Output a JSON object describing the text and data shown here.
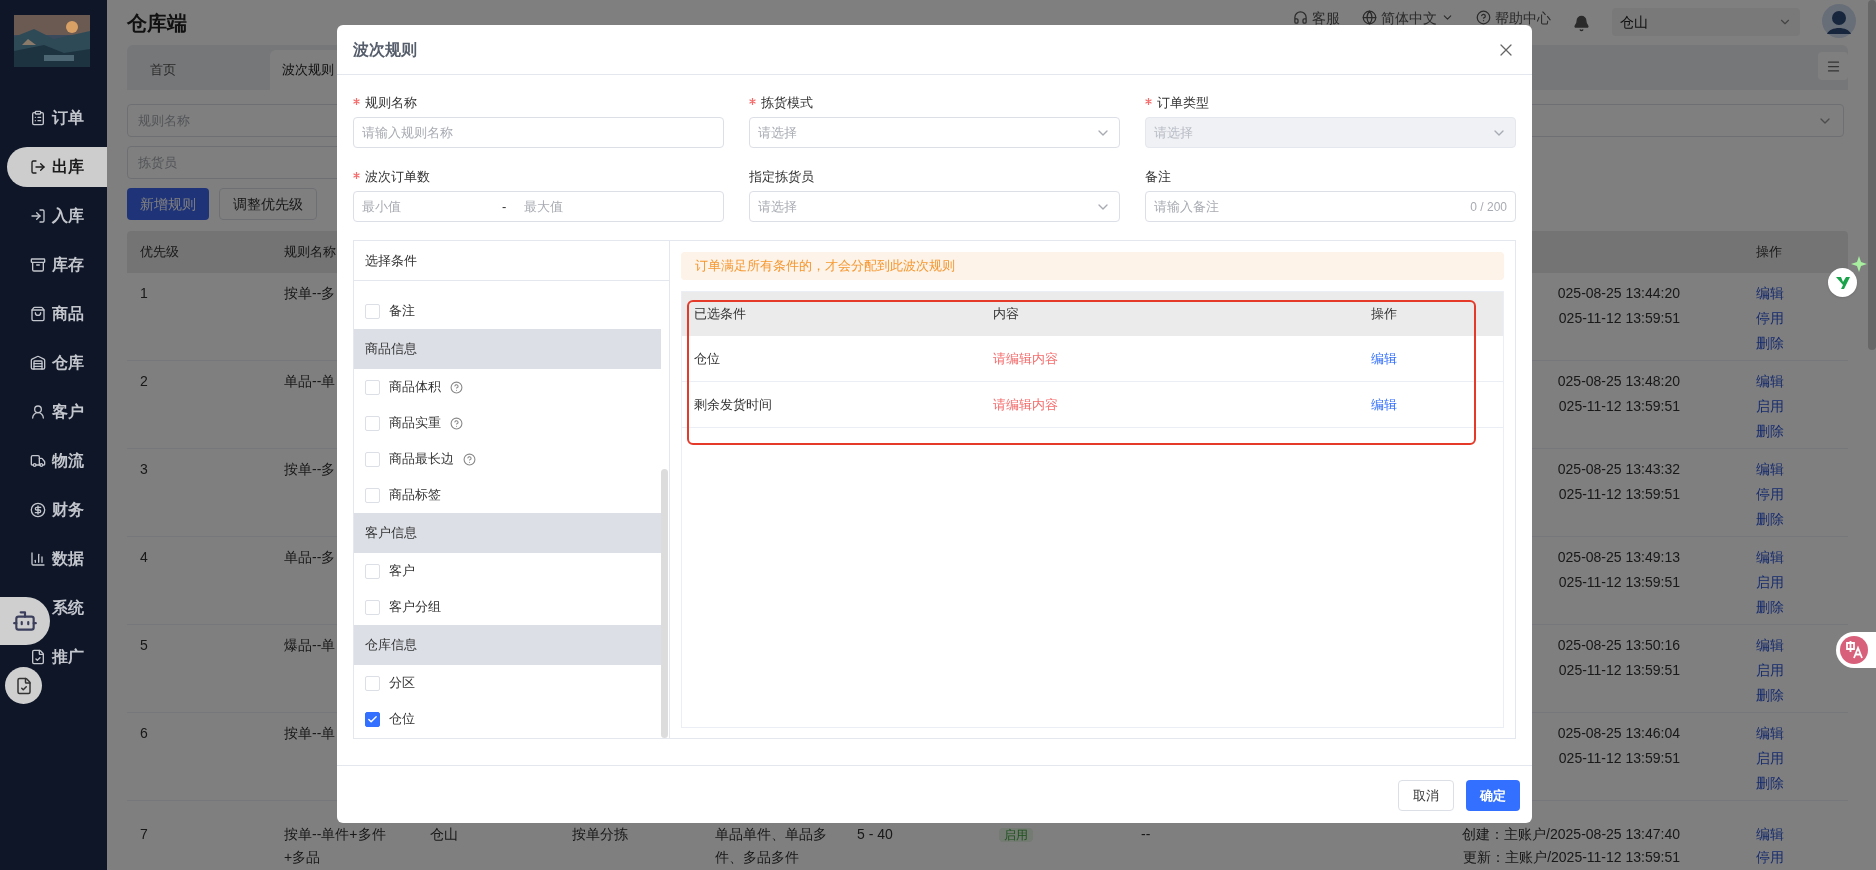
{
  "sidebar": {
    "items": [
      {
        "label": "订单",
        "selected": false
      },
      {
        "label": "出库",
        "selected": true
      },
      {
        "label": "入库",
        "selected": false
      },
      {
        "label": "库存",
        "selected": false
      },
      {
        "label": "商品",
        "selected": false
      },
      {
        "label": "仓库",
        "selected": false
      },
      {
        "label": "客户",
        "selected": false
      },
      {
        "label": "物流",
        "selected": false
      },
      {
        "label": "财务",
        "selected": false
      },
      {
        "label": "数据",
        "selected": false
      },
      {
        "label": "系统",
        "selected": false
      },
      {
        "label": "推广",
        "selected": false
      }
    ]
  },
  "header": {
    "title": "仓库端",
    "links": [
      "客服",
      "简体中文",
      "帮助中心"
    ],
    "warehouse_select": "仓山"
  },
  "tabs": [
    {
      "label": "首页",
      "selected": false
    },
    {
      "label": "波次规则",
      "selected": true
    }
  ],
  "filters": {
    "fields": [
      {
        "placeholder": "规则名称"
      },
      {
        "placeholder": "拣货员"
      }
    ],
    "buttons": [
      {
        "label": "新增规则",
        "kind": "primary"
      },
      {
        "label": "调整优先级",
        "kind": "default"
      }
    ]
  },
  "table": {
    "columns": [
      "优先级",
      "规则名称",
      "操作"
    ],
    "rows": [
      {
        "priority": "1",
        "name": [
          "按单--多"
        ],
        "created": "025-08-25 13:44:20",
        "updated": "025-11-12 13:59:51",
        "actions": [
          "编辑",
          "停用",
          "删除"
        ]
      },
      {
        "priority": "2",
        "name": [
          "单品--单"
        ],
        "created": "025-08-25 13:48:20",
        "updated": "025-11-12 13:59:51",
        "actions": [
          "编辑",
          "启用",
          "删除"
        ]
      },
      {
        "priority": "3",
        "name": [
          "按单--多"
        ],
        "created": "025-08-25 13:43:32",
        "updated": "025-11-12 13:59:51",
        "actions": [
          "编辑",
          "停用",
          "删除"
        ]
      },
      {
        "priority": "4",
        "name": [
          "单品--多"
        ],
        "created": "025-08-25 13:49:13",
        "updated": "025-11-12 13:59:51",
        "actions": [
          "编辑",
          "启用",
          "删除"
        ]
      },
      {
        "priority": "5",
        "name": [
          "爆品--单"
        ],
        "created": "025-08-25 13:50:16",
        "updated": "025-11-12 13:59:51",
        "actions": [
          "编辑",
          "启用",
          "删除"
        ]
      },
      {
        "priority": "6",
        "name": [
          "按单--单"
        ],
        "created": "025-08-25 13:46:04",
        "updated": "025-11-12 13:59:51",
        "actions": [
          "编辑",
          "启用",
          "删除"
        ]
      },
      {
        "priority": "7",
        "name": [
          "按单--单件+多件",
          "+多品"
        ],
        "warehouse": "仓山",
        "pick_mode": "按单分拣",
        "order_type": [
          "单品单件、单品多",
          "件、多品多件"
        ],
        "order_count": "5 - 40",
        "status": "启用",
        "picker": "--",
        "created": "创建：主账户/2025-08-25 13:47:40",
        "updated": "更新：主账户/2025-11-12 13:59:51",
        "actions": [
          "编辑",
          "停用"
        ]
      }
    ]
  },
  "modal": {
    "title": "波次规则",
    "fields": [
      {
        "label": "规则名称",
        "required": true,
        "kind": "input",
        "placeholder": "请输入规则名称",
        "disabled": false
      },
      {
        "label": "拣货模式",
        "required": true,
        "kind": "select",
        "placeholder": "请选择",
        "disabled": false
      },
      {
        "label": "订单类型",
        "required": true,
        "kind": "select",
        "placeholder": "请选择",
        "disabled": true
      },
      {
        "label": "波次订单数",
        "required": true,
        "kind": "range",
        "placeholders": [
          "最小值",
          "最大值"
        ],
        "separator": "-",
        "disabled": false
      },
      {
        "label": "指定拣货员",
        "required": false,
        "kind": "select",
        "placeholder": "请选择",
        "disabled": false
      },
      {
        "label": "备注",
        "required": false,
        "kind": "textarea",
        "placeholder": "请输入备注",
        "counter": "0 / 200",
        "disabled": false
      }
    ],
    "conditions_title": "选择条件",
    "conditions": [
      {
        "kind": "option",
        "label": "备注",
        "checked": false,
        "help": false
      },
      {
        "kind": "group",
        "label": "商品信息"
      },
      {
        "kind": "option",
        "label": "商品体积",
        "checked": false,
        "help": true
      },
      {
        "kind": "option",
        "label": "商品实重",
        "checked": false,
        "help": true
      },
      {
        "kind": "option",
        "label": "商品最长边",
        "checked": false,
        "help": true
      },
      {
        "kind": "option",
        "label": "商品标签",
        "checked": false,
        "help": false
      },
      {
        "kind": "group",
        "label": "客户信息"
      },
      {
        "kind": "option",
        "label": "客户",
        "checked": false,
        "help": false
      },
      {
        "kind": "option",
        "label": "客户分组",
        "checked": false,
        "help": false
      },
      {
        "kind": "group",
        "label": "仓库信息"
      },
      {
        "kind": "option",
        "label": "分区",
        "checked": false,
        "help": false
      },
      {
        "kind": "option",
        "label": "仓位",
        "checked": true,
        "help": false
      }
    ],
    "hint": "订单满足所有条件的，才会分配到此波次规则",
    "selected_table": {
      "columns": [
        "已选条件",
        "内容",
        "操作"
      ],
      "rows": [
        {
          "condition": "仓位",
          "content": "请编辑内容",
          "action": "编辑"
        },
        {
          "condition": "剩余发货时间",
          "content": "请编辑内容",
          "action": "编辑"
        }
      ]
    },
    "buttons": [
      {
        "label": "取消",
        "kind": "default"
      },
      {
        "label": "确定",
        "kind": "primary"
      }
    ]
  }
}
